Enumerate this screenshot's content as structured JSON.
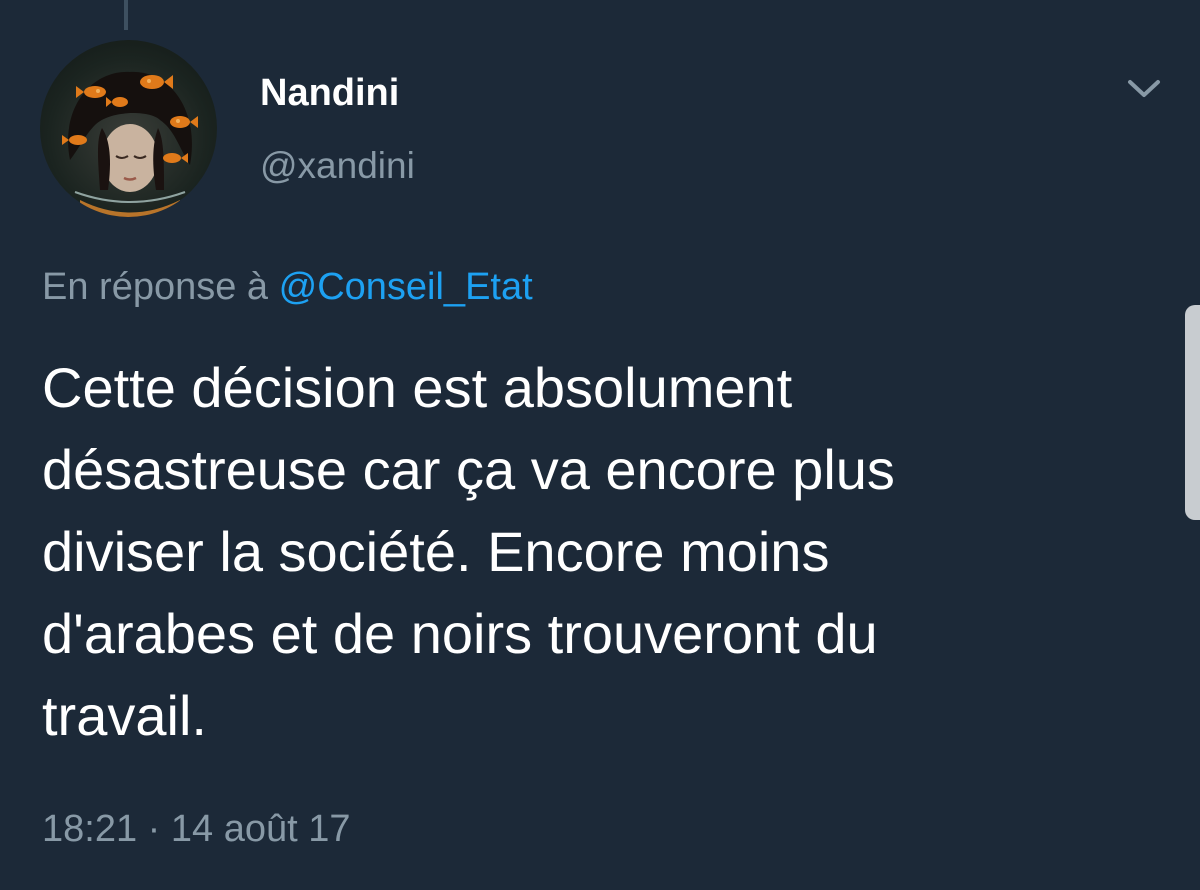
{
  "tweet": {
    "display_name": "Nandini",
    "handle": "@xandini",
    "reply_prefix": "En réponse à",
    "reply_mention": "@Conseil_Etat",
    "text_lines": [
      "Cette décision est absolument",
      "désastreuse car ça va encore plus",
      "diviser la société. Encore moins",
      "d'arabes et de noirs trouveront du",
      "travail."
    ],
    "timestamp": "18:21 · 14 août 17"
  },
  "icons": {
    "menu": "chevron-down-icon",
    "avatar": "avatar-image"
  },
  "colors": {
    "background": "#1c2938",
    "primary_text": "#ffffff",
    "secondary_text": "#8899a6",
    "link": "#1da1f2"
  }
}
